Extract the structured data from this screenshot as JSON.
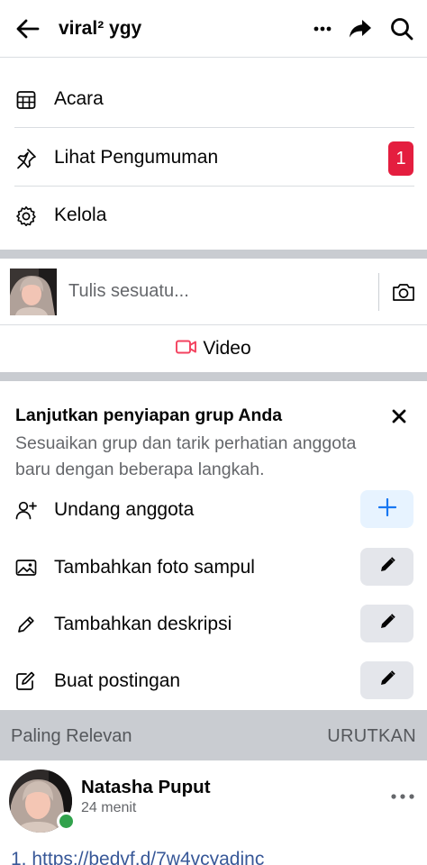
{
  "header": {
    "title": "viral² ygy"
  },
  "menu": [
    {
      "label": "Acara",
      "icon": "calendar-icon"
    },
    {
      "label": "Lihat Pengumuman",
      "icon": "pin-icon",
      "badge": "1"
    },
    {
      "label": "Kelola",
      "icon": "gear-icon"
    }
  ],
  "composer": {
    "placeholder": "Tulis sesuatu...",
    "video_label": "Video"
  },
  "setup": {
    "title": "Lanjutkan penyiapan grup Anda",
    "description": "Sesuaikan grup dan tarik perhatian anggota baru dengan beberapa langkah.",
    "tasks": [
      {
        "label": "Undang anggota",
        "icon": "add-person-icon",
        "action_icon": "plus-icon"
      },
      {
        "label": "Tambahkan foto sampul",
        "icon": "image-icon",
        "action_icon": "pencil-icon"
      },
      {
        "label": "Tambahkan deskripsi",
        "icon": "pencil-icon",
        "action_icon": "pencil-icon"
      },
      {
        "label": "Buat postingan",
        "icon": "compose-icon",
        "action_icon": "pencil-icon"
      }
    ]
  },
  "feed": {
    "sort_label": "Paling Relevan",
    "sort_action": "URUTKAN"
  },
  "post": {
    "author": "Natasha Puput",
    "time": "24 menit",
    "text": "1. https://bedvf.d/7w4vcyadinc"
  },
  "colors": {
    "badge": "#e41e3f",
    "online": "#31a24c",
    "video": "#f3425f",
    "plus": "#1877f2",
    "divider": "#c9ccd1"
  }
}
